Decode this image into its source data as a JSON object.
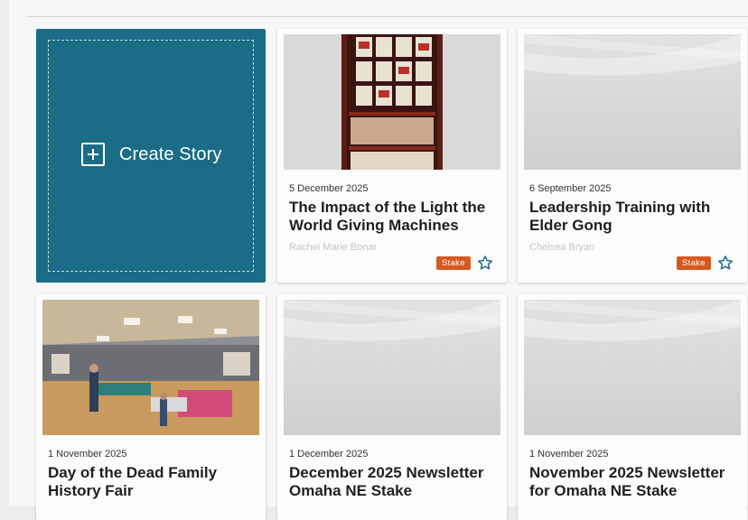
{
  "create_story": {
    "label": "Create Story"
  },
  "stories": [
    {
      "date": "5 December 2025",
      "title": "The Impact of the Light the World Giving Machines",
      "author": "Rachel Marie Bonar",
      "badge": "Stake",
      "image": "giving-machine-photo"
    },
    {
      "date": "6 September 2025",
      "title": "Leadership Training with Elder Gong",
      "author": "Chelsea Bryan",
      "badge": "Stake",
      "image": "placeholder"
    },
    {
      "date": "1 November 2025",
      "title": "Day of the Dead Family History Fair",
      "image": "gym-event-photo"
    },
    {
      "date": "1 December 2025",
      "title": "December 2025 Newsletter Omaha NE Stake",
      "image": "placeholder"
    },
    {
      "date": "1 November 2025",
      "title": "November 2025 Newsletter for Omaha NE Stake",
      "image": "placeholder"
    }
  ],
  "colors": {
    "create_bg": "#1a6c87",
    "badge_bg": "#d45a1f",
    "star": "#1a6c87"
  }
}
